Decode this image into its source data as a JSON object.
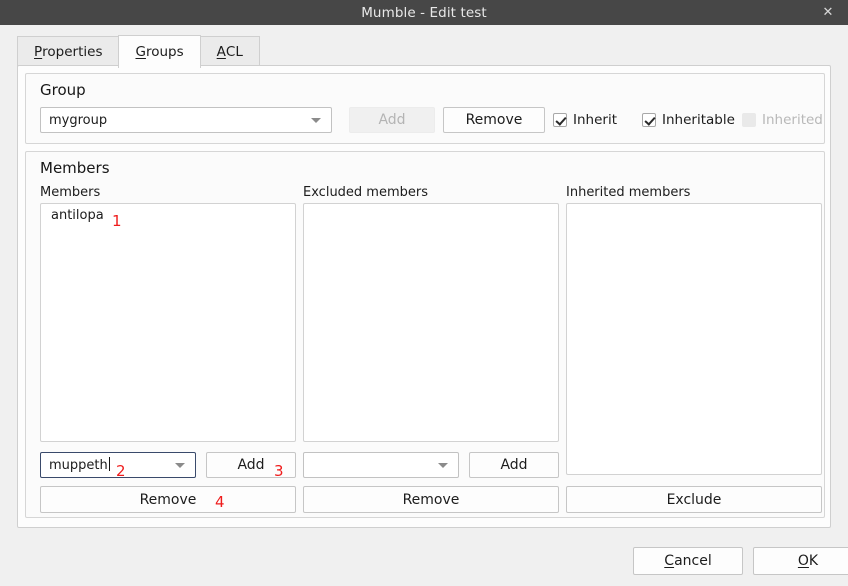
{
  "window": {
    "title": "Mumble - Edit test",
    "close_label": "✕"
  },
  "tabs": [
    {
      "label": "Properties",
      "mnemonic": "P",
      "active": false
    },
    {
      "label": "Groups",
      "mnemonic": "G",
      "active": true
    },
    {
      "label": "ACL",
      "mnemonic": "A",
      "active": false
    }
  ],
  "group_section": {
    "title": "Group",
    "combo_value": "mygroup",
    "add_label": "Add",
    "add_enabled": false,
    "remove_label": "Remove",
    "checkboxes": [
      {
        "label": "Inherit",
        "checked": true,
        "enabled": true
      },
      {
        "label": "Inheritable",
        "checked": true,
        "enabled": true
      },
      {
        "label": "Inherited",
        "checked": false,
        "enabled": false
      }
    ]
  },
  "members_section": {
    "title": "Members",
    "columns": [
      {
        "header": "Members",
        "items": [
          "antilopa"
        ],
        "combo_value": "muppeth",
        "combo_focused": true,
        "add_label": "Add",
        "action_label": "Remove"
      },
      {
        "header": "Excluded members",
        "items": [],
        "combo_value": "",
        "combo_focused": false,
        "add_label": "Add",
        "action_label": "Remove"
      },
      {
        "header": "Inherited members",
        "items": [],
        "action_label": "Exclude"
      }
    ]
  },
  "annotations": [
    {
      "text": "1"
    },
    {
      "text": "2"
    },
    {
      "text": "3"
    },
    {
      "text": "4"
    }
  ],
  "dialog_buttons": {
    "cancel": {
      "label": "Cancel",
      "mnemonic": "C"
    },
    "ok": {
      "label": "OK",
      "mnemonic": "O"
    }
  },
  "colors": {
    "titlebar": "#474747",
    "window_bg": "#f0f0f0",
    "panel_bg": "#fdfdfd",
    "annotation": "#ef1c1c",
    "focus_border": "#3a4a6b"
  }
}
